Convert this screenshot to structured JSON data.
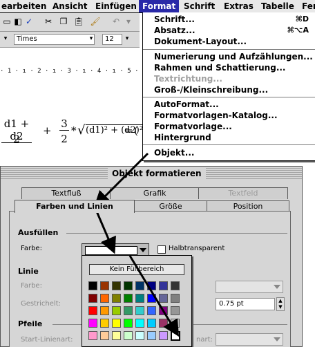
{
  "menubar": {
    "items": [
      {
        "label": "earbeiten",
        "active": false
      },
      {
        "label": "Ansicht",
        "active": false
      },
      {
        "label": "Einfügen",
        "active": false
      },
      {
        "label": "Format",
        "active": true
      },
      {
        "label": "Schrift",
        "active": false
      },
      {
        "label": "Extras",
        "active": false
      },
      {
        "label": "Tabelle",
        "active": false
      },
      {
        "label": "Fen",
        "active": false
      }
    ]
  },
  "toolbar": {
    "font_name": "Times",
    "font_size": "12",
    "ruler_text": "· 1 · ı · 2 · ı · 3 · ı · 4 · ı · 5 · ı · 6 ·"
  },
  "document": {
    "formula": {
      "frac1_num": "d1 + d2",
      "frac1_den": "2",
      "plus": "+",
      "frac2_num": "3",
      "frac2_den": "2",
      "times": "*",
      "root": "(d1)² + (d2)²",
      "equals": "=",
      "tail": "("
    }
  },
  "format_menu": {
    "items": [
      {
        "label": "Schrift...",
        "shortcut": "⌘D",
        "disabled": false
      },
      {
        "label": "Absatz...",
        "shortcut": "⌘⌥A",
        "disabled": false
      },
      {
        "label": "Dokument-Layout...",
        "shortcut": "",
        "disabled": false
      },
      {
        "label": "Numerierung und Aufzählungen...",
        "shortcut": "",
        "disabled": false
      },
      {
        "label": "Rahmen und Schattierung...",
        "shortcut": "",
        "disabled": false
      },
      {
        "label": "Textrichtung...",
        "shortcut": "",
        "disabled": true
      },
      {
        "label": "Groß-/Kleinschreibung...",
        "shortcut": "",
        "disabled": false
      },
      {
        "label": "AutoFormat...",
        "shortcut": "",
        "disabled": false
      },
      {
        "label": "Formatvorlagen-Katalog...",
        "shortcut": "",
        "disabled": false
      },
      {
        "label": "Formatvorlage...",
        "shortcut": "",
        "disabled": false
      },
      {
        "label": "Hintergrund",
        "shortcut": "",
        "disabled": false
      },
      {
        "label": "Objekt...",
        "shortcut": "",
        "disabled": false
      }
    ]
  },
  "dialog": {
    "title": "Objekt formatieren",
    "tabs_back": [
      {
        "label": "Textfluß",
        "disabled": false
      },
      {
        "label": "Grafik",
        "disabled": false
      },
      {
        "label": "Textfeld",
        "disabled": true
      }
    ],
    "tabs_front": [
      {
        "label": "Farben und Linien",
        "selected": true
      },
      {
        "label": "Größe",
        "selected": false
      },
      {
        "label": "Position",
        "selected": false
      }
    ],
    "fill_section": "Ausfüllen",
    "fill_color_label": "Farbe:",
    "semi_transparent_label": "Halbtransparent",
    "line_section": "Linie",
    "line_color_label": "Farbe:",
    "dashed_label": "Gestrichelt:",
    "weight_value": "0.75 pt",
    "arrows_section": "Pfeile",
    "start_style_label": "Start-Linienart:",
    "end_style_label_partial": "nart:"
  },
  "palette": {
    "no_fill_label": "Kein Füllbereich",
    "colors": [
      [
        "#000000",
        "#993300",
        "#333300",
        "#003300",
        "#003366",
        "#000080",
        "#333399",
        "#333333"
      ],
      [
        "#800000",
        "#FF6600",
        "#808000",
        "#008000",
        "#008080",
        "#0000FF",
        "#666699",
        "#808080"
      ],
      [
        "#FF0000",
        "#FF9900",
        "#99CC00",
        "#339966",
        "#33CCCC",
        "#3366FF",
        "#800080",
        "#969696"
      ],
      [
        "#FF00FF",
        "#FFCC00",
        "#FFFF00",
        "#00FF00",
        "#00FFFF",
        "#00CCFF",
        "#993366",
        "#C0C0C0"
      ],
      [
        "#FF99CC",
        "#FFCC99",
        "#FFFF99",
        "#CCFFCC",
        "#CCFFFF",
        "#99CCFF",
        "#CC99FF",
        "#FFFFFF"
      ]
    ]
  },
  "colors": {
    "menu_highlight": "#2929a8",
    "dialog_bg": "#d6d6d6"
  }
}
